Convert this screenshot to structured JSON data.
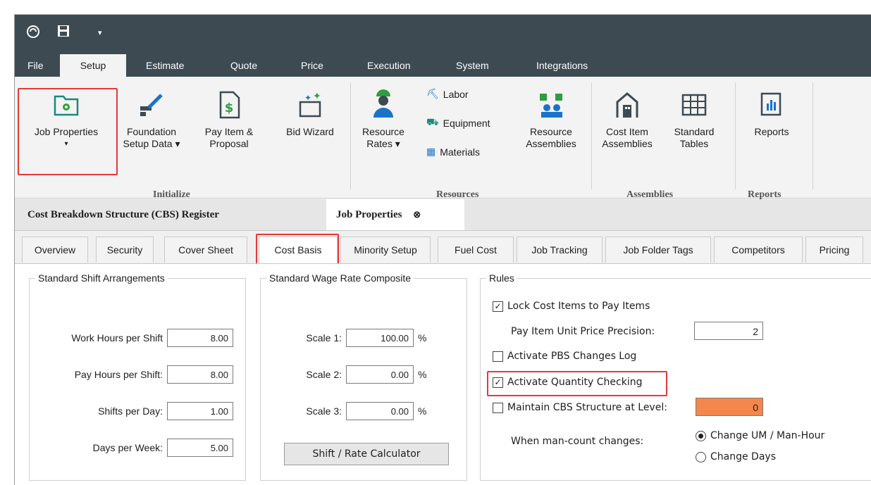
{
  "menu": {
    "tabs": [
      "File",
      "Setup",
      "Estimate",
      "Quote",
      "Price",
      "Execution",
      "System",
      "Integrations"
    ],
    "active": "Setup"
  },
  "ribbon": {
    "job_properties": "Job Properties",
    "foundation_line1": "Foundation",
    "foundation_line2": "Setup Data ▾",
    "payitem_line1": "Pay Item &",
    "payitem_line2": "Proposal",
    "bid_wizard": "Bid Wizard",
    "resource_rates_line1": "Resource",
    "resource_rates_line2": "Rates ▾",
    "labor": "Labor",
    "equipment": "Equipment",
    "materials": "Materials",
    "resource_assemblies_line1": "Resource",
    "resource_assemblies_line2": "Assemblies",
    "cost_item_line1": "Cost Item",
    "cost_item_line2": "Assemblies",
    "standard_tables_line1": "Standard",
    "standard_tables_line2": "Tables",
    "reports": "Reports",
    "groups": {
      "initialize": "Initialize",
      "resources": "Resources",
      "assemblies": "Assemblies",
      "reports": "Reports"
    }
  },
  "doc_tabs": {
    "cbs": "Cost Breakdown Structure (CBS) Register",
    "job": "Job Properties"
  },
  "sub_tabs": [
    "Overview",
    "Security",
    "Cover Sheet",
    "Cost Basis",
    "Minority Setup",
    "Fuel Cost",
    "Job Tracking",
    "Job Folder Tags",
    "Competitors",
    "Pricing"
  ],
  "shift": {
    "legend": "Standard Shift Arrangements",
    "work_hours_label": "Work Hours per Shift",
    "work_hours": "8.00",
    "pay_hours_label": "Pay Hours per Shift:",
    "pay_hours": "8.00",
    "shifts_label": "Shifts per Day:",
    "shifts": "1.00",
    "days_label": "Days per Week:",
    "days": "5.00"
  },
  "wage": {
    "legend": "Standard Wage Rate Composite",
    "scale1_label": "Scale 1:",
    "scale1": "100.00",
    "scale2_label": "Scale 2:",
    "scale2": "0.00",
    "scale3_label": "Scale 3:",
    "scale3": "0.00",
    "pct": "%",
    "calc_button": "Shift / Rate Calculator"
  },
  "rules": {
    "legend": "Rules",
    "lock_cost": "Lock Cost Items to Pay Items",
    "lock_cost_checked": true,
    "precision_label": "Pay Item Unit Price Precision:",
    "precision": "2",
    "pbs_log": "Activate PBS Changes Log",
    "pbs_log_checked": false,
    "qty_check": "Activate Quantity Checking",
    "qty_check_checked": true,
    "maintain_cbs": "Maintain CBS Structure at Level:",
    "maintain_cbs_checked": false,
    "cbs_level": "0",
    "man_count_label": "When man-count changes:",
    "opt_um": "Change UM / Man-Hour",
    "opt_days": "Change Days",
    "selected": "Change UM / Man-Hour"
  },
  "colors": {
    "title_bar": "#3d4a52",
    "highlight": "#e03b3b",
    "orange_field": "#f4874b",
    "icon_teal": "#1a8a7a"
  }
}
